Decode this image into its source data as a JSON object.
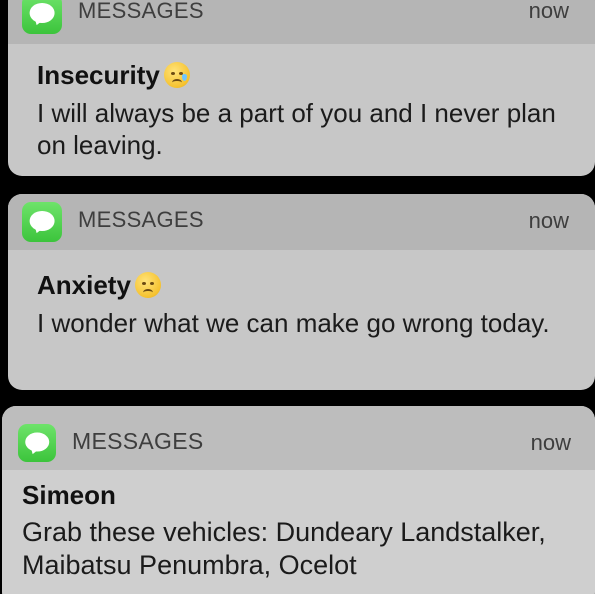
{
  "notifications": [
    {
      "app_name": "MESSAGES",
      "time": "now",
      "sender": "Insecurity",
      "emoji": "crying-face-icon",
      "body": "I will always be a part of you and I never plan on leaving."
    },
    {
      "app_name": "MESSAGES",
      "time": "now",
      "sender": "Anxiety",
      "emoji": "disappointed-face-icon",
      "body": "I wonder what we can make go wrong today."
    },
    {
      "app_name": "MESSAGES",
      "time": "now",
      "sender": "Simeon",
      "body": "Grab these vehicles: Dundeary Landstalker, Maibatsu Penumbra, Ocelot"
    }
  ],
  "colors": {
    "app_icon_green": "#4cd964",
    "card_background": "#c7c7c7",
    "header_background": "#b5b5b5"
  }
}
